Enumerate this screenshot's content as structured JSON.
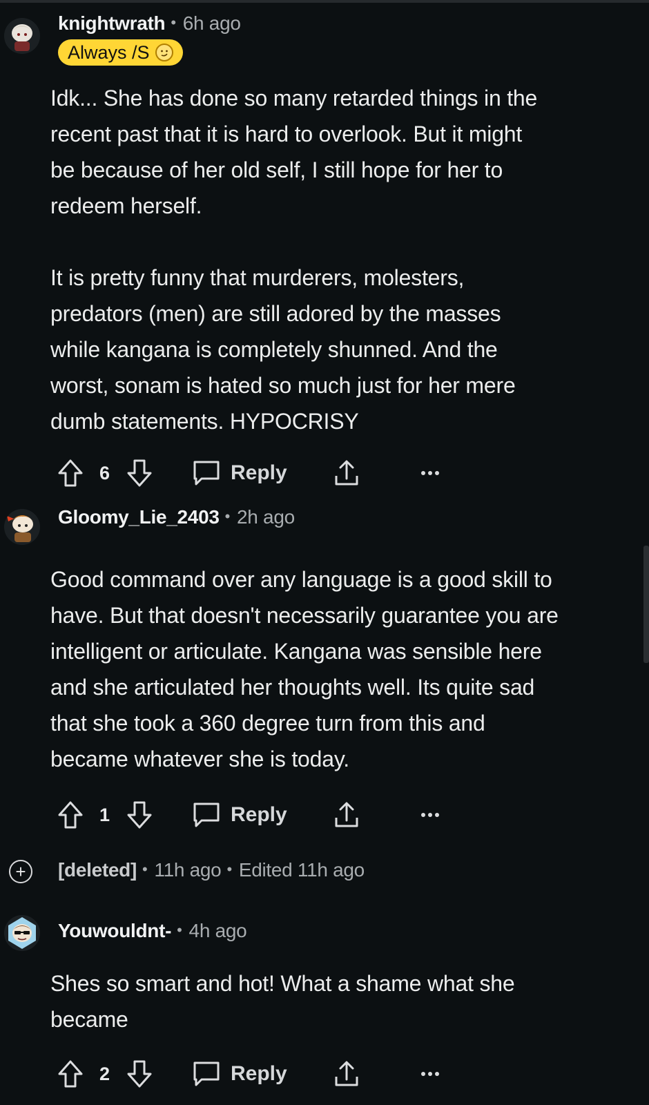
{
  "comments": [
    {
      "username": "knightwrath",
      "time": "6h ago",
      "flair": "Always /S",
      "body": "Idk... She has done so many retarded things in the\nrecent past that it is hard to overlook. But it might\nbe because of her old self, I still hope for her to\nredeem herself.\n\nIt is pretty funny that murderers, molesters,\npredators (men) are still adored by the masses\nwhile kangana is completely shunned. And the\nworst, sonam is hated so much just for her mere\ndumb statements. HYPOCRISY",
      "score": "6",
      "reply_label": "Reply"
    },
    {
      "username": "Gloomy_Lie_2403",
      "time": "2h ago",
      "body": "Good command over any language is a good skill to\nhave. But that doesn't necessarily guarantee you are\nintelligent or articulate. Kangana was sensible here\nand she articulated her thoughts well. Its quite sad\nthat she took a 360 degree turn from this and\nbecame whatever she is today.",
      "score": "1",
      "reply_label": "Reply"
    },
    {
      "username": "Youwouldnt-",
      "time": "4h ago",
      "body": "Shes so smart and hot! What a shame what she\nbecame",
      "score": "2",
      "reply_label": "Reply"
    }
  ],
  "deleted": {
    "label": "[deleted]",
    "time": "11h ago",
    "edited": "Edited 11h ago"
  },
  "separator": "•",
  "icons": {
    "upvote": "arrow-up-outline-icon",
    "downvote": "arrow-down-outline-icon",
    "reply": "speech-bubble-icon",
    "share": "share-upload-icon",
    "more": "ellipsis-icon",
    "expand": "plus-circle-icon"
  },
  "colors": {
    "background": "#0c1012",
    "flair": "#ffd635",
    "text": "#eceded",
    "muted": "#a9adb0"
  }
}
